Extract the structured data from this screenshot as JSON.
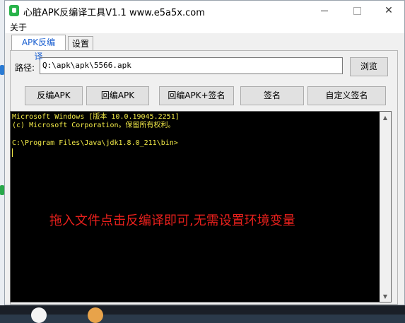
{
  "window": {
    "title": "心脏APK反编译工具V1.1 www.e5a5x.com",
    "close_glyph": "✕"
  },
  "menu": {
    "about": "关于"
  },
  "tabs": [
    {
      "label": "APK反编译",
      "active": true
    },
    {
      "label": "设置",
      "active": false
    }
  ],
  "path": {
    "label": "路径:",
    "value": "Q:\\apk\\apk\\5566.apk",
    "browse_label": "浏览"
  },
  "actions": {
    "decompile": "反编APK",
    "recompile": "回编APK",
    "recompile_sign": "回编APK+签名",
    "sign": "签名",
    "custom_sign": "自定义签名"
  },
  "console": {
    "lines": [
      "Microsoft Windows [版本 10.0.19045.2251]",
      "(c) Microsoft Corporation。保留所有权利。",
      "C:\\Program Files\\Java\\jdk1.8.0_211\\bin>"
    ],
    "text_color": "#f2ea48",
    "overlay_text": "拖入文件点击反编译即可,无需设置环境变量",
    "overlay_color": "#e8201c",
    "scroll_up": "▲",
    "scroll_down": "▼"
  }
}
